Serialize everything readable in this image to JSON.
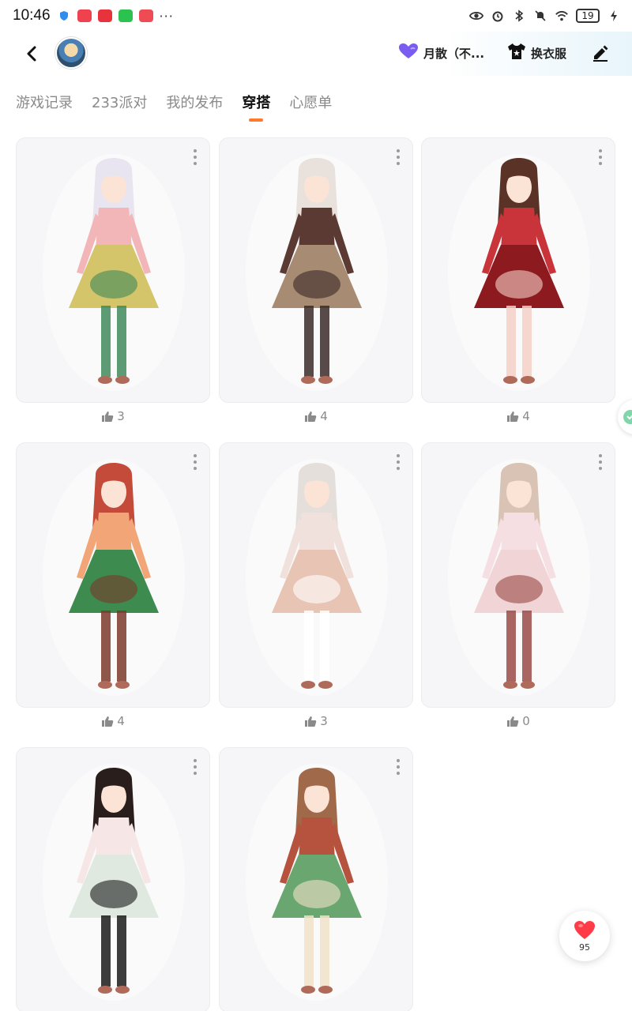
{
  "status_bar": {
    "time": "10:46",
    "more": "···",
    "battery": "19"
  },
  "header": {
    "mood_label": "月散（不...",
    "dress_label": "换衣服"
  },
  "tabs": [
    {
      "label": "游戏记录",
      "active": false
    },
    {
      "label": "233派对",
      "active": false
    },
    {
      "label": "我的发布",
      "active": false
    },
    {
      "label": "穿搭",
      "active": true
    },
    {
      "label": "心愿单",
      "active": false
    }
  ],
  "outfits": [
    {
      "likes": "3",
      "palette": [
        "#e8e4f0",
        "#f2b6b9",
        "#d4c46a",
        "#3f8a5a"
      ]
    },
    {
      "likes": "4",
      "palette": [
        "#e9e1dc",
        "#5b3a34",
        "#a78b72",
        "#3a2a28"
      ]
    },
    {
      "likes": "4",
      "palette": [
        "#5a3326",
        "#c9333a",
        "#8c1a1f",
        "#f4d0c7"
      ]
    },
    {
      "likes": "4",
      "palette": [
        "#c44a3a",
        "#f2a677",
        "#3e8b4f",
        "#7a3a2a"
      ]
    },
    {
      "likes": "3",
      "palette": [
        "#e5dfdb",
        "#f0e1dc",
        "#e8c4b4",
        "#ffffff"
      ]
    },
    {
      "likes": "0",
      "palette": [
        "#d8c3b4",
        "#f6dfe3",
        "#f0d4d6",
        "#9a4a45"
      ]
    },
    {
      "likes": "",
      "palette": [
        "#2a1e1c",
        "#f7e6e6",
        "#dfe9df",
        "#1a1a1a"
      ]
    },
    {
      "likes": "",
      "palette": [
        "#a06a4a",
        "#b5533e",
        "#6aa670",
        "#f1e2c8"
      ]
    }
  ],
  "fab": {
    "count": "95"
  },
  "colors": {
    "accent": "#ff7a2b",
    "heart": "#ff3b47",
    "mood_heart": "#7a5cf0"
  }
}
